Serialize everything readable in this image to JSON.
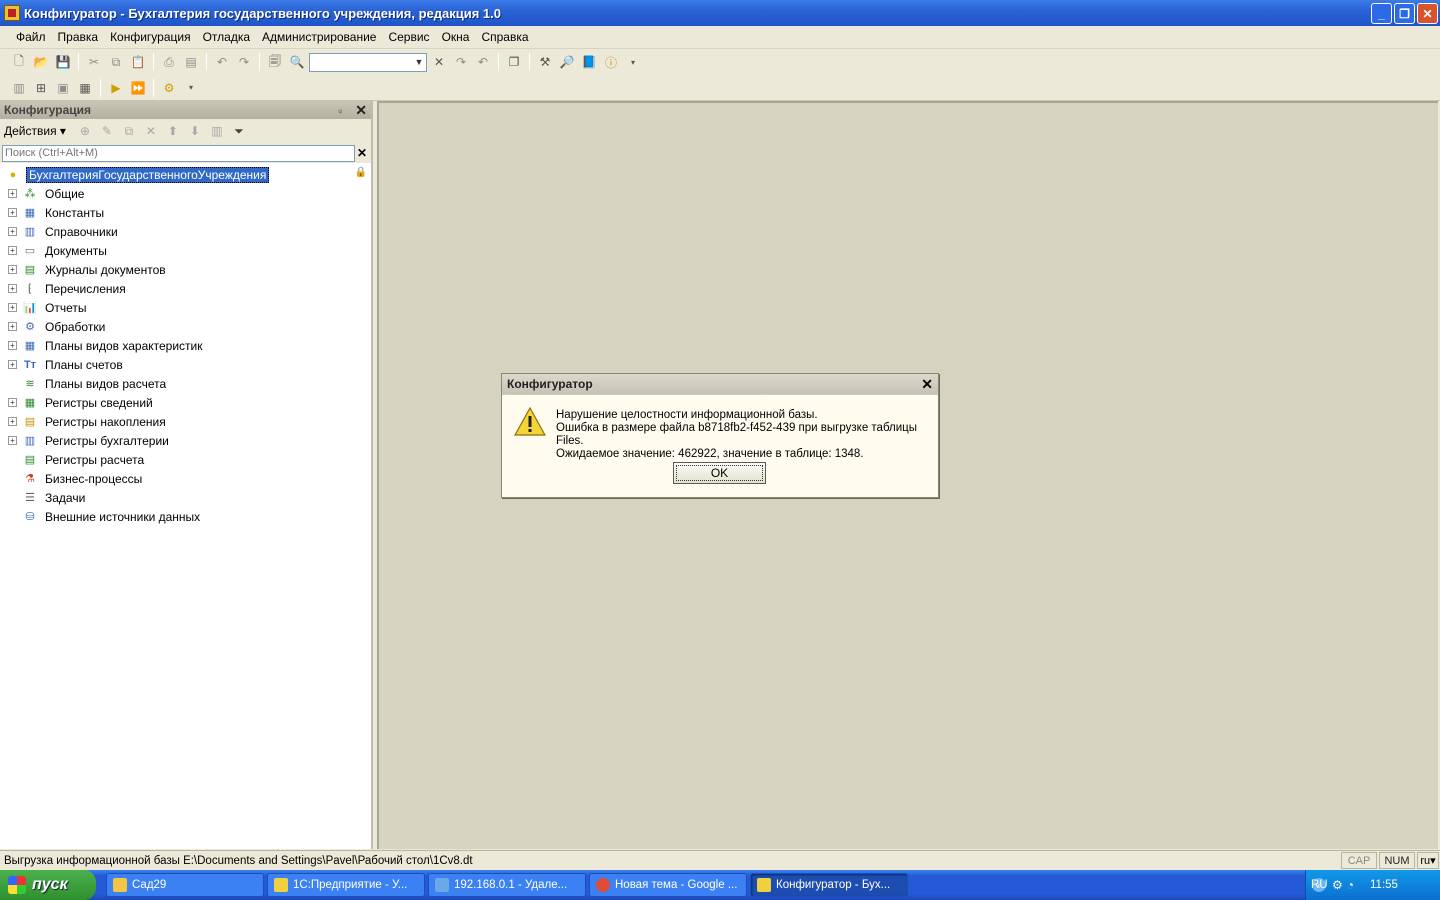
{
  "window": {
    "title": "Конфигуратор - Бухгалтерия государственного учреждения, редакция 1.0",
    "buttons": [
      "_",
      "❐",
      "✕"
    ]
  },
  "menu": [
    "Файл",
    "Правка",
    "Конфигурация",
    "Отладка",
    "Администрирование",
    "Сервис",
    "Окна",
    "Справка"
  ],
  "panel": {
    "title": "Конфигурация",
    "actions_label": "Действия",
    "search_placeholder": "Поиск (Ctrl+Alt+M)",
    "root": "БухгалтерияГосударственногоУчреждения",
    "items": [
      {
        "label": "Общие",
        "icon": "common-icon",
        "expandable": true
      },
      {
        "label": "Константы",
        "icon": "constants-icon",
        "expandable": true
      },
      {
        "label": "Справочники",
        "icon": "catalogs-icon",
        "expandable": true
      },
      {
        "label": "Документы",
        "icon": "documents-icon",
        "expandable": true
      },
      {
        "label": "Журналы документов",
        "icon": "journals-icon",
        "expandable": true
      },
      {
        "label": "Перечисления",
        "icon": "enums-icon",
        "expandable": true
      },
      {
        "label": "Отчеты",
        "icon": "reports-icon",
        "expandable": true
      },
      {
        "label": "Обработки",
        "icon": "dataprocessors-icon",
        "expandable": true
      },
      {
        "label": "Планы видов характеристик",
        "icon": "charts-of-characteristics-icon",
        "expandable": true
      },
      {
        "label": "Планы счетов",
        "icon": "charts-of-accounts-icon",
        "expandable": true
      },
      {
        "label": "Планы видов расчета",
        "icon": "charts-of-calculation-icon",
        "expandable": false
      },
      {
        "label": "Регистры сведений",
        "icon": "info-registers-icon",
        "expandable": true
      },
      {
        "label": "Регистры накопления",
        "icon": "accum-registers-icon",
        "expandable": true
      },
      {
        "label": "Регистры бухгалтерии",
        "icon": "accounting-registers-icon",
        "expandable": true
      },
      {
        "label": "Регистры расчета",
        "icon": "calc-registers-icon",
        "expandable": false
      },
      {
        "label": "Бизнес-процессы",
        "icon": "business-processes-icon",
        "expandable": false
      },
      {
        "label": "Задачи",
        "icon": "tasks-icon",
        "expandable": false
      },
      {
        "label": "Внешние источники данных",
        "icon": "external-sources-icon",
        "expandable": false
      }
    ]
  },
  "dialog": {
    "title": "Конфигуратор",
    "line1": "Нарушение целостности информационной базы.",
    "line2": "Ошибка в размере файла b8718fb2-f452-439 при выгрузке таблицы Files.",
    "line3": "Ожидаемое значение: 462922, значение в таблице: 1348.",
    "ok": "OK"
  },
  "status": {
    "text": "Выгрузка информационной базы E:\\Documents and Settings\\Pavel\\Рабочий стол\\1Cv8.dt",
    "cap": "CAP",
    "num": "NUM",
    "lang": "ru"
  },
  "taskbar": {
    "start": "пуск",
    "tasks": [
      {
        "label": "Сад29",
        "color": "#f3c544",
        "active": false
      },
      {
        "label": "1С:Предприятие - У...",
        "color": "#f0d040",
        "active": false
      },
      {
        "label": "192.168.0.1 - Удале...",
        "color": "#6aa8e8",
        "active": false
      },
      {
        "label": "Новая тема - Google ...",
        "color": "#e04b3a",
        "active": false
      },
      {
        "label": "Конфигуратор - Бух...",
        "color": "#f0d040",
        "active": true
      }
    ],
    "lang": "RU",
    "time": "11:55"
  }
}
